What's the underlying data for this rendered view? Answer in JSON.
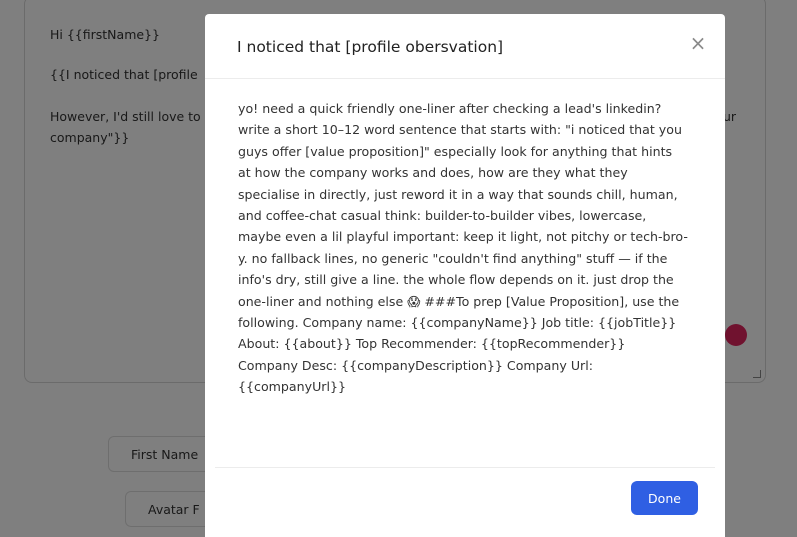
{
  "editor": {
    "line1": "Hi {{firstName}}",
    "line2": "{{I noticed that [profile",
    "line3": "However, I'd still love to",
    "line4": "company\"}}",
    "right_fragment": "ur"
  },
  "buttons": {
    "first_name": "First Name",
    "avatar": "Avatar F"
  },
  "modal": {
    "title": "I noticed that [profile obersvation]",
    "close_glyph": "×",
    "body": "yo! need a quick friendly one-liner after checking a lead's linkedin? write a short 10–12 word sentence that starts with: \"i noticed that you guys offer [value proposition]\" especially look for anything that hints at how the company works and does, how are they what they specialise in directly, just reword it in a way that sounds chill, human, and coffee-chat casual think: builder-to-builder vibes, lowercase, maybe even a lil playful important: keep it light, not pitchy or tech-bro-y. no fallback lines, no generic \"couldn't find anything\" stuff — if the info's dry, still give a line. the whole flow depends on it. just drop the one-liner and nothing else 😱 ###To prep [Value Proposition], use the following. Company name: {{companyName}} Job title: {{jobTitle}} About: {{about}} Top Recommender: {{topRecommender}} Company Desc: {{companyDescription}} Company Url: {{companyUrl}}",
    "done_label": "Done"
  }
}
